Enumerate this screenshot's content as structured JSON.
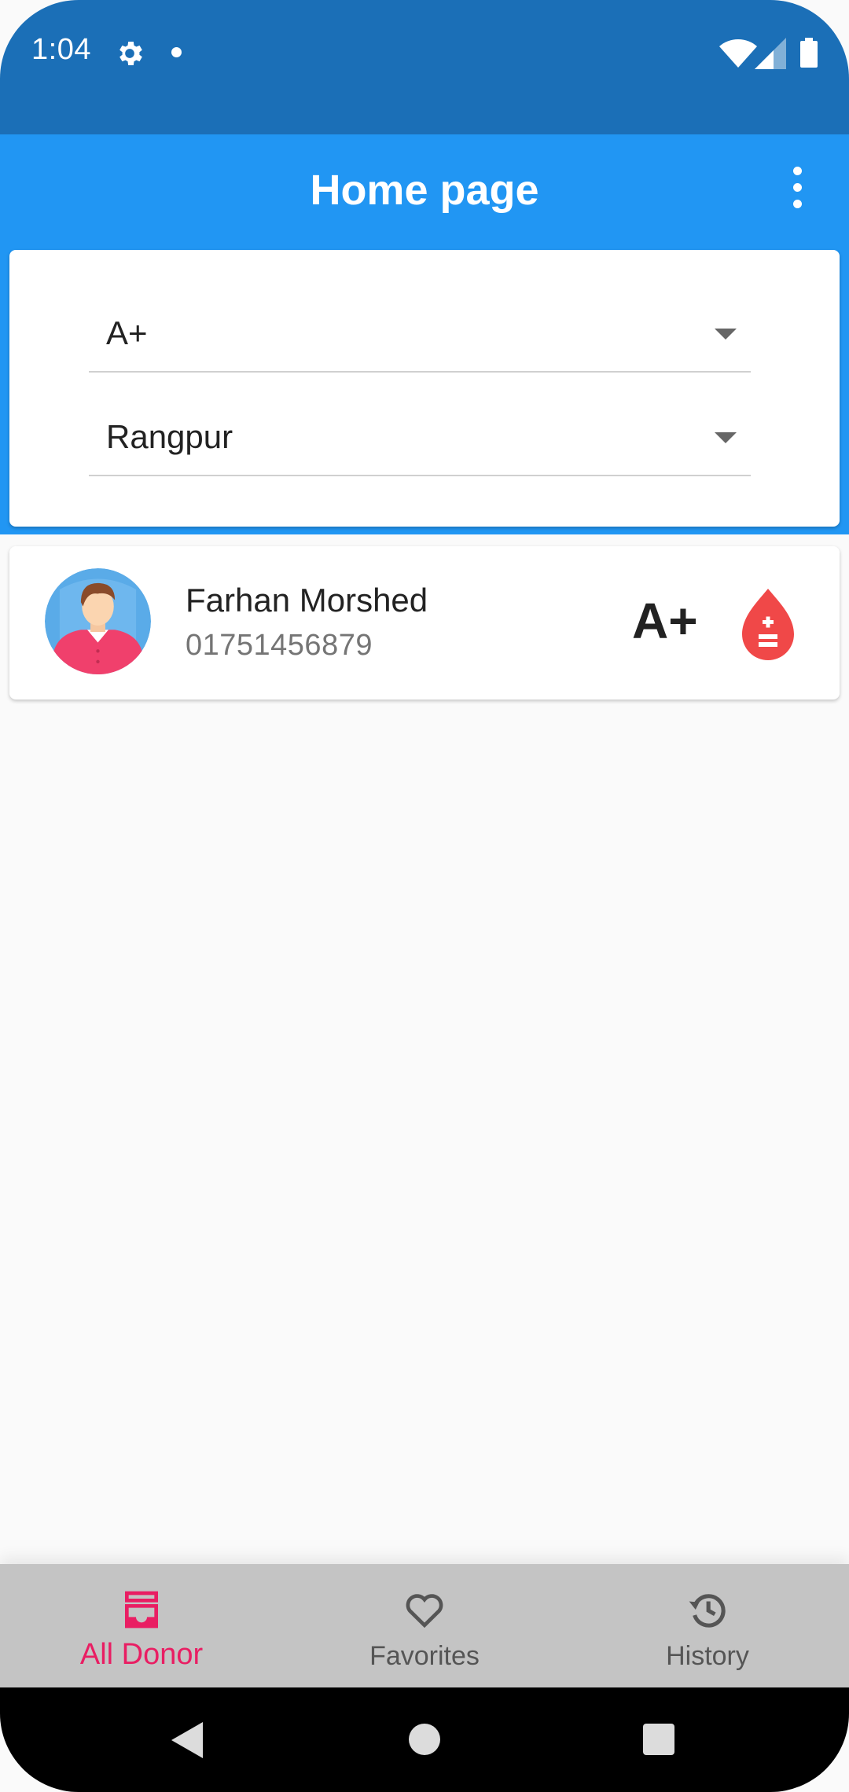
{
  "status_bar": {
    "time": "1:04",
    "icons": [
      "settings-icon",
      "notification-dot-icon",
      "wifi-icon",
      "signal-icon",
      "battery-icon"
    ]
  },
  "app_bar": {
    "title": "Home page",
    "menu_icon": "more-vert-icon"
  },
  "filters": {
    "blood_group": {
      "value": "A+"
    },
    "city": {
      "value": "Rangpur"
    }
  },
  "donors": [
    {
      "name": "Farhan Morshed",
      "phone": "01751456879",
      "blood_group": "A+",
      "avatar_icon": "person-avatar-icon",
      "action_icon": "blood-drop-icon"
    }
  ],
  "bottom_nav": {
    "items": [
      {
        "label": "All Donor",
        "icon": "inbox-icon",
        "active": true
      },
      {
        "label": "Favorites",
        "icon": "heart-icon",
        "active": false
      },
      {
        "label": "History",
        "icon": "history-icon",
        "active": false
      }
    ]
  },
  "colors": {
    "status_bar": "#1b6fb7",
    "app_bar": "#2196f3",
    "accent": "#e91e63",
    "blood_red": "#f44336",
    "nav_background": "#c4c4c4"
  }
}
